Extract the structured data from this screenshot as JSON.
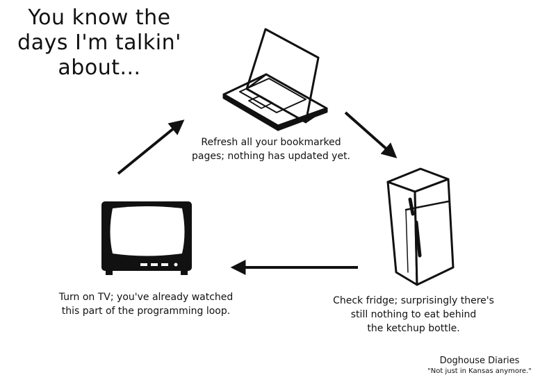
{
  "title": {
    "line1": "You know the",
    "line2": "days I'm talkin'",
    "line3": "about..."
  },
  "steps": [
    {
      "icon": "laptop-icon",
      "line1": "Refresh all your bookmarked",
      "line2": "pages; nothing has updated yet."
    },
    {
      "icon": "fridge-icon",
      "line1": "Check fridge; surprisingly there's",
      "line2": "still nothing to eat behind",
      "line3": "the ketchup bottle."
    },
    {
      "icon": "tv-icon",
      "line1": "Turn on TV; you've already watched",
      "line2": "this part of the programming loop."
    }
  ],
  "credit": {
    "name": "Doghouse Diaries",
    "tagline": "\"Not just in Kansas anymore.\""
  },
  "colors": {
    "ink": "#111111",
    "background": "#ffffff"
  }
}
